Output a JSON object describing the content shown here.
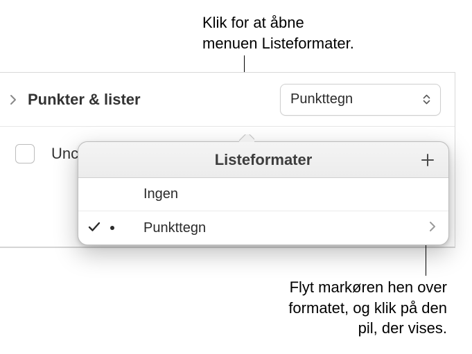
{
  "callouts": {
    "top_line1": "Klik for at åbne",
    "top_line2": "menuen Listeformater.",
    "bottom_line1": "Flyt markøren hen over",
    "bottom_line2": "formatet, og klik på den",
    "bottom_line3": "pil, der vises."
  },
  "panel": {
    "section_label": "Punkter & lister",
    "dropdown_value": "Punkttegn",
    "truncated_label": "Unci"
  },
  "popover": {
    "title": "Listeformater",
    "items": [
      {
        "label": "Ingen",
        "selected": false,
        "has_bullet": false,
        "has_arrow": false
      },
      {
        "label": "Punkttegn",
        "selected": true,
        "has_bullet": true,
        "has_arrow": true
      }
    ]
  },
  "icons": {
    "chevron_right": "chevron-right-icon",
    "chevron_up_down": "chevron-up-down-icon",
    "plus": "plus-icon",
    "check": "checkmark-icon",
    "bullet": "bullet-icon"
  }
}
